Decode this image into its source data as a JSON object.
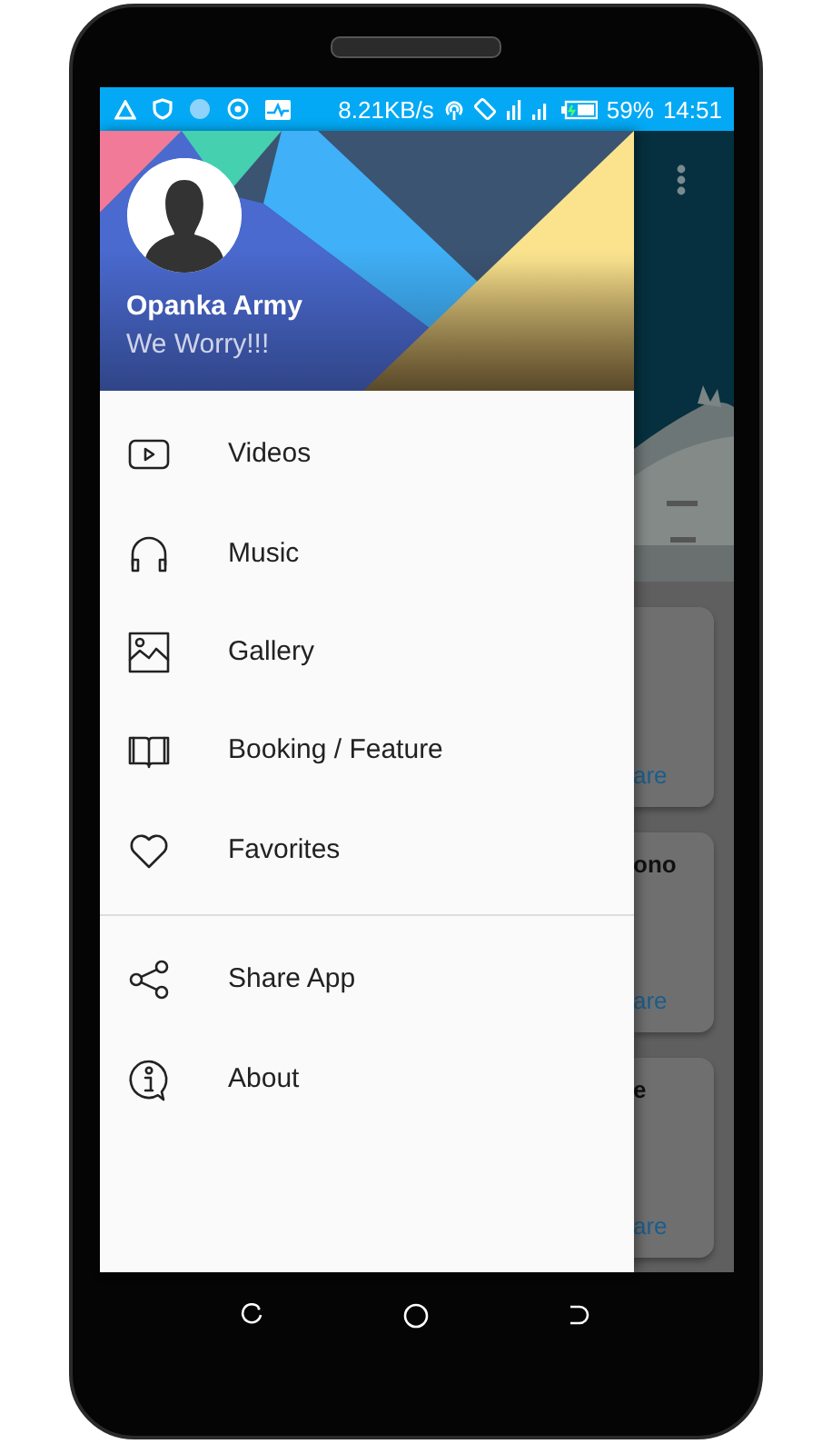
{
  "status_bar": {
    "speed": "8.21KB/s",
    "battery": "59%",
    "time": "14:51"
  },
  "drawer": {
    "header": {
      "name": "Opanka Army",
      "subtitle": "We Worry!!!"
    },
    "sections": [
      {
        "items": [
          {
            "label": "Videos"
          },
          {
            "label": "Music"
          },
          {
            "label": "Gallery"
          },
          {
            "label": "Booking / Feature"
          },
          {
            "label": "Favorites"
          }
        ]
      },
      {
        "items": [
          {
            "label": "Share App"
          },
          {
            "label": "About"
          }
        ]
      }
    ]
  },
  "background_content": {
    "cards": [
      {
        "action": "are"
      },
      {
        "title": "ono",
        "action": "are"
      },
      {
        "title": "e",
        "action": "are"
      }
    ]
  }
}
